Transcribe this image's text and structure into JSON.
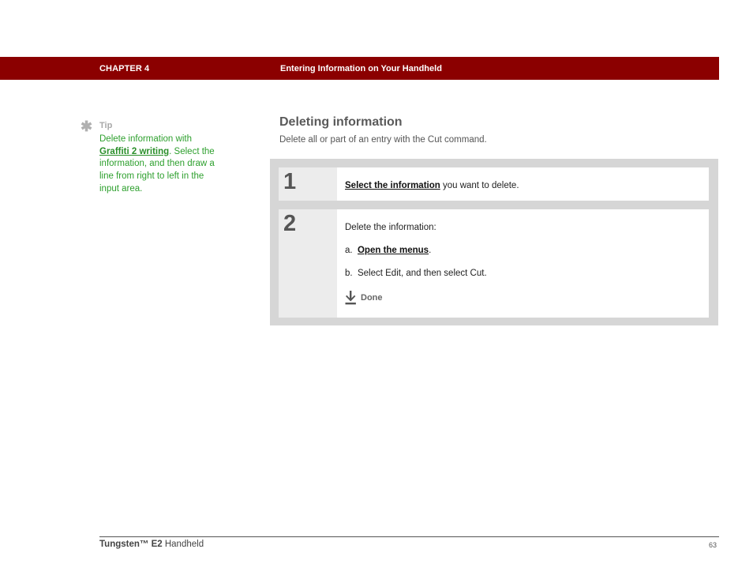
{
  "header": {
    "chapter": "CHAPTER 4",
    "title": "Entering Information on Your Handheld",
    "bar_color": "#8b0000"
  },
  "tip": {
    "icon": "asterisk-icon",
    "label": "Tip",
    "text_before": "Delete information with ",
    "link": "Graffiti 2 writing",
    "text_after": ". Select the information, and then draw a line from right to left in the input area.",
    "color": "#2ea02e"
  },
  "section": {
    "title": "Deleting information",
    "subtitle": "Delete all or part of an entry with the Cut command."
  },
  "steps": [
    {
      "number": "1",
      "link": "Select the information",
      "text": " you want to delete."
    },
    {
      "number": "2",
      "intro": "Delete the information:",
      "sub_a_prefix": "a.",
      "sub_a_link": "Open the menus",
      "sub_a_suffix": ".",
      "sub_b_prefix": "b.",
      "sub_b_text": "Select Edit, and then select Cut.",
      "done_icon": "down-arrow-icon",
      "done_label": "Done"
    }
  ],
  "footer": {
    "product_bold": "Tungsten™ E2",
    "product_rest": " Handheld",
    "page": "63"
  }
}
